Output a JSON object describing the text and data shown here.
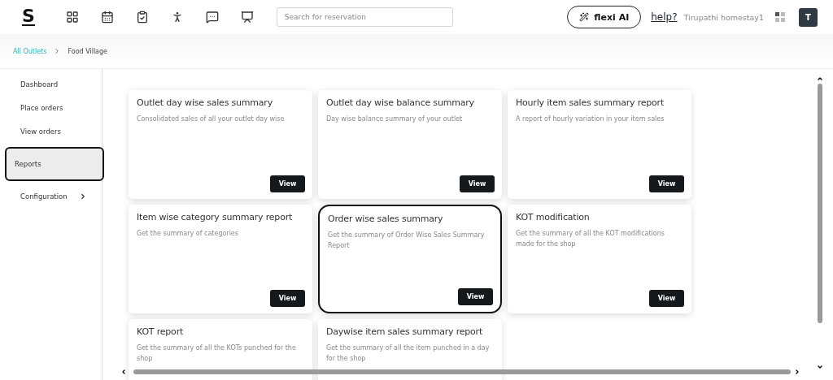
{
  "header": {
    "logo": "S",
    "search": {
      "placeholder": "Search for reservation"
    },
    "ai_button": "flexi AI",
    "help_link": "help?",
    "account_name": "Tirupathi homestay1",
    "avatar": "T"
  },
  "breadcrumb": [
    {
      "label": "All Outlets",
      "kind": "link"
    },
    {
      "label": "Food Village",
      "kind": "current"
    }
  ],
  "sidebar": {
    "items": [
      {
        "label": "Dashboard",
        "selected": false,
        "highlighted": false,
        "has_submenu": false
      },
      {
        "label": "Place orders",
        "selected": false,
        "highlighted": false,
        "has_submenu": false
      },
      {
        "label": "View orders",
        "selected": false,
        "highlighted": false,
        "has_submenu": false
      },
      {
        "label": "Reports",
        "selected": true,
        "highlighted": true,
        "has_submenu": false
      },
      {
        "label": "Configuration",
        "selected": false,
        "highlighted": false,
        "has_submenu": true
      }
    ]
  },
  "reports": [
    {
      "title": "Outlet day wise sales summary",
      "description": "Consolidated sales of all your outlet day wise",
      "button": "View",
      "highlighted": false
    },
    {
      "title": "Outlet day wise balance summary",
      "description": "Day wise balance summary of your outlet",
      "button": "View",
      "highlighted": false
    },
    {
      "title": "Hourly item sales summary report",
      "description": "A report of hourly variation in your item sales",
      "button": "View",
      "highlighted": false
    },
    {
      "title": "Item wise category summary report",
      "description": "Get the summary of categories",
      "button": "View",
      "highlighted": false
    },
    {
      "title": "Order wise sales summary",
      "description": "Get the summary of Order Wise Sales Summary Report",
      "button": "View",
      "highlighted": true
    },
    {
      "title": "KOT modification",
      "description": "Get the summary of all the KOT modifications made for the shop",
      "button": "View",
      "highlighted": false
    },
    {
      "title": "KOT report",
      "description": "Get the summary of all the KOTs punched for the shop",
      "highlighted": false
    },
    {
      "title": "Daywise item sales summary report",
      "description": "Get the summary of all the item punched in a day for the shop",
      "highlighted": false
    }
  ]
}
